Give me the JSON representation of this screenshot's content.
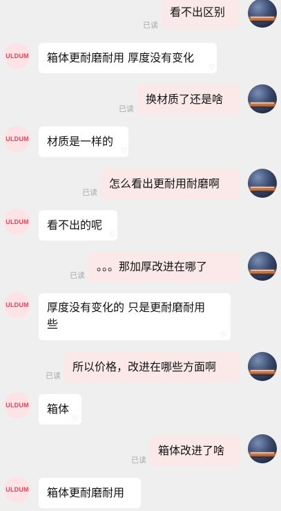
{
  "brand": {
    "avatar_text": "ULDUM"
  },
  "read_label": "已读",
  "messages": [
    {
      "side": "right",
      "text": "看不出区别"
    },
    {
      "side": "left",
      "text": "箱体更耐磨耐用 厚度没有变化"
    },
    {
      "side": "right",
      "text": "换材质了还是啥"
    },
    {
      "side": "left",
      "text": "材质是一样的"
    },
    {
      "side": "right",
      "text": "怎么看出更耐用耐磨啊"
    },
    {
      "side": "left",
      "text": "看不出的呢"
    },
    {
      "side": "right",
      "text": "。。。那加厚改进在哪了"
    },
    {
      "side": "left",
      "text_line1": "厚度没有变化的 只是更耐磨耐用",
      "text_line2": "些"
    },
    {
      "side": "right",
      "text": "所以价格，改进在哪些方面啊"
    },
    {
      "side": "left",
      "text": "箱体"
    },
    {
      "side": "right",
      "text": "箱体改进了啥"
    },
    {
      "side": "left",
      "text": "箱体更耐磨耐用"
    }
  ],
  "colors": {
    "background": "#efefef",
    "left_bubble": "#ffffff",
    "right_bubble": "#fbe9ea",
    "brand_red": "#d9455a"
  }
}
